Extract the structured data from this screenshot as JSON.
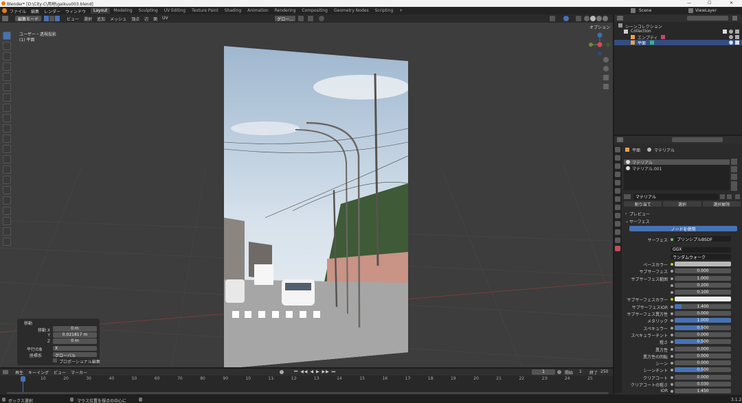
{
  "window": {
    "title": "Blender* [D:\\City-C\\用地\\gaikuu003.blend]",
    "btn_min": "—",
    "btn_max": "☐",
    "btn_close": "✕"
  },
  "menu": {
    "items": [
      "ファイル",
      "編集",
      "レンダー",
      "ウィンドウ",
      "ヘルプ"
    ]
  },
  "workspaces": [
    "Layout",
    "Modeling",
    "Sculpting",
    "UV Editing",
    "Texture Paint",
    "Shading",
    "Animation",
    "Rendering",
    "Compositing",
    "Geometry Nodes",
    "Scripting"
  ],
  "workspace_add": "+",
  "scene": {
    "name": "Scene",
    "view_layer": "ViewLayer"
  },
  "viewport": {
    "mode": "編集モード",
    "menus": [
      "ビュー",
      "選択",
      "追加",
      "メッシュ",
      "頂点",
      "辺",
      "面",
      "UV"
    ],
    "transform": "グロー...",
    "options": "オプション",
    "info_line1": "ユーザー・透視投影",
    "info_line2": "(1) 平面",
    "gizmo_x": "X",
    "gizmo_y": "Y",
    "gizmo_z": "Z"
  },
  "tool_icons": [
    "select-box-icon",
    "cursor-icon",
    "move-icon",
    "rotate-icon",
    "scale-icon",
    "transform-icon",
    "annotate-icon",
    "measure-icon",
    "add-cube-icon",
    "extrude-icon",
    "inset-icon",
    "bevel-icon",
    "loop-cut-icon",
    "knife-icon",
    "poly-build-icon",
    "spin-icon",
    "smooth-icon",
    "edge-slide-icon",
    "shrink-icon",
    "shear-icon",
    "rip-icon"
  ],
  "operator_panel": {
    "title": "移動",
    "rows": [
      {
        "label": "移動 X",
        "value": "0 m"
      },
      {
        "label": "Y",
        "value": "0.021817 m"
      },
      {
        "label": "Z",
        "value": "0 m"
      }
    ],
    "axis_label": "平行の軸",
    "axis_value": "X",
    "orient_label": "座標系",
    "orient_value": "グローバル",
    "prop_edit": "プロポーショナル編集"
  },
  "outliner": {
    "title": "シーンコレクション",
    "items": [
      {
        "label": "Collection"
      },
      {
        "label": "エンプティ"
      },
      {
        "label": "平面"
      }
    ]
  },
  "properties": {
    "breadcrumb_obj": "平面",
    "breadcrumb_mat": "マテリアル",
    "slots": [
      "マテリアル",
      "マテリアル.001"
    ],
    "material_name": "マテリアル",
    "assign": "割り当て",
    "select": "選択",
    "deselect": "選択解除",
    "preview": "プレビュー",
    "surface_section": "サーフェス",
    "use_nodes": "ノードを使用",
    "surface_label": "サーフェス",
    "surface_value": "プリンシプルBSDF",
    "distribution": "GGX",
    "sss_method": "ランダムウォーク",
    "rows": [
      {
        "label": "ベースカラー",
        "value": "",
        "kind": "color",
        "color": "#b9b9b9"
      },
      {
        "label": "サブサーフェス",
        "value": "0.000",
        "kind": "num"
      },
      {
        "label": "サブサーフェス範囲",
        "value": "1.000",
        "kind": "num"
      },
      {
        "label": "",
        "value": "0.200",
        "kind": "num"
      },
      {
        "label": "",
        "value": "0.100",
        "kind": "num"
      },
      {
        "label": "サブサーフェスカラー",
        "value": "",
        "kind": "color",
        "color": "#eeeeee"
      },
      {
        "label": "サブサーフェスIOR",
        "value": "1.400",
        "kind": "bar",
        "fill": 0.12
      },
      {
        "label": "サブサーフェス異方性",
        "value": "0.000",
        "kind": "num"
      },
      {
        "label": "メタリック",
        "value": "1.000",
        "kind": "bar",
        "fill": 1.0
      },
      {
        "label": "スペキュラー",
        "value": "0.500",
        "kind": "bar",
        "fill": 0.5
      },
      {
        "label": "スペキュラーチント",
        "value": "0.000",
        "kind": "num"
      },
      {
        "label": "粗さ",
        "value": "0.500",
        "kind": "bar",
        "fill": 0.5
      },
      {
        "label": "異方性",
        "value": "0.000",
        "kind": "num"
      },
      {
        "label": "異方性の回転",
        "value": "0.000",
        "kind": "num"
      },
      {
        "label": "シーン",
        "value": "0.000",
        "kind": "num"
      },
      {
        "label": "シーンチント",
        "value": "0.500",
        "kind": "bar",
        "fill": 0.5
      },
      {
        "label": "クリアコート",
        "value": "0.000",
        "kind": "num"
      },
      {
        "label": "クリアコートの粗さ",
        "value": "0.030",
        "kind": "num"
      },
      {
        "label": "IOR",
        "value": "1.450",
        "kind": "num"
      }
    ]
  },
  "timeline": {
    "menus": [
      "再生",
      "キーイング",
      "ビュー",
      "マーカー"
    ],
    "current_frame": "1",
    "start_label": "開始",
    "start": "1",
    "end_label": "終了",
    "end": "250",
    "ticks": [
      "1",
      "10",
      "20",
      "30",
      "40",
      "50",
      "60",
      "70",
      "80",
      "90",
      "100",
      "110",
      "120",
      "130",
      "140",
      "150",
      "160",
      "170",
      "180",
      "190",
      "200",
      "210",
      "220",
      "230",
      "240",
      "250"
    ]
  },
  "statusbar": {
    "left": "ボックス選択",
    "mid": "マウス位置を視点の中心に",
    "version": "3.1.2"
  },
  "colors": {
    "accent": "#4772b3",
    "header": "#2b2b2b",
    "panel": "#303030",
    "active_tab": "#3d3d3d"
  }
}
